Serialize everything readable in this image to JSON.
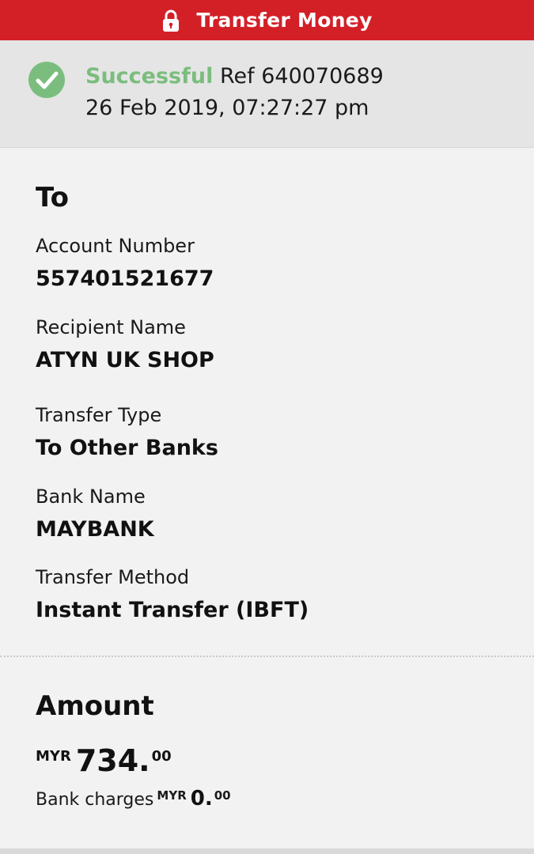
{
  "header": {
    "title": "Transfer Money",
    "icon": "lock-icon",
    "bg_color": "#d32027"
  },
  "status": {
    "icon": "check-circle-icon",
    "state": "Successful",
    "ref_label": "Ref",
    "ref_number": "640070689",
    "datetime": "26 Feb 2019, 07:27:27 pm",
    "state_color": "#7bbd7e"
  },
  "to_section": {
    "title": "To",
    "fields": [
      {
        "label": "Account Number",
        "value": "557401521677"
      },
      {
        "label": "Recipient Name",
        "value": "ATYN UK SHOP"
      },
      {
        "label": "Transfer Type",
        "value": "To Other Banks"
      },
      {
        "label": "Bank Name",
        "value": "MAYBANK"
      },
      {
        "label": "Transfer Method",
        "value": "Instant Transfer (IBFT)"
      }
    ]
  },
  "amount_section": {
    "title": "Amount",
    "currency": "MYR",
    "amount_main": "734.",
    "amount_decimal": "00",
    "charges_label": "Bank charges",
    "charges_currency": "MYR",
    "charges_main": "0.",
    "charges_decimal": "00"
  }
}
